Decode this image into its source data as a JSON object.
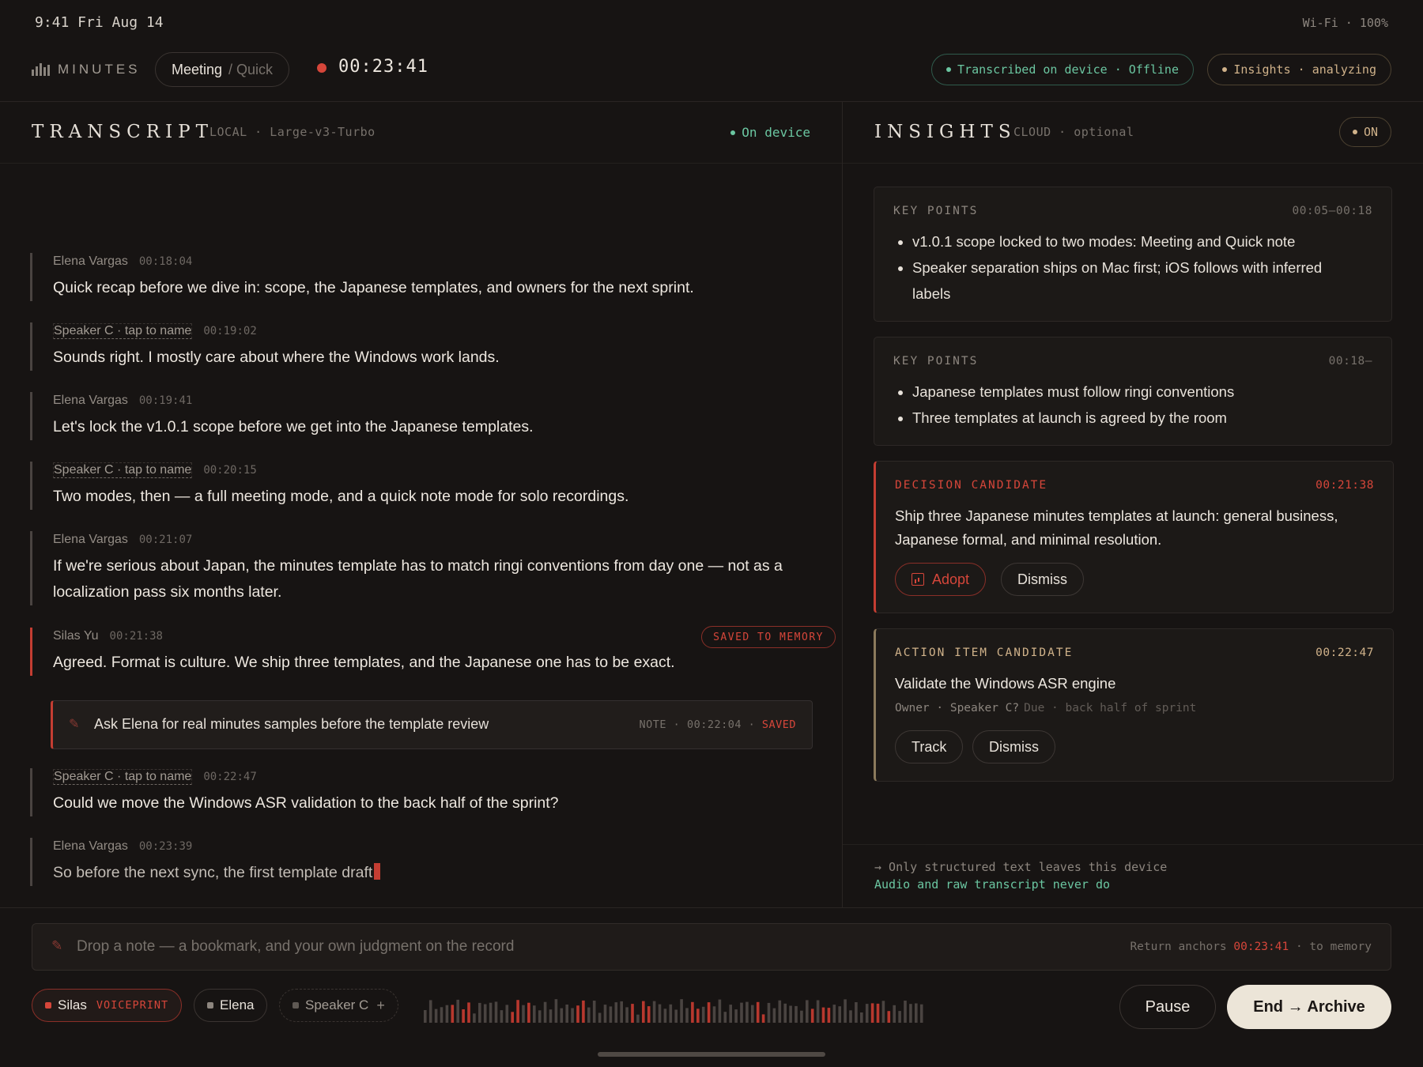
{
  "status": {
    "time": "9:41 Fri Aug 14",
    "system": "Wi-Fi · 100%"
  },
  "header": {
    "brand": "MINUTES",
    "mode_primary": "Meeting",
    "mode_secondary": "/ Quick",
    "timer": "00:23:41",
    "transcribed_pill": "Transcribed on device · Offline",
    "insights_pill": "Insights · analyzing"
  },
  "transcript": {
    "title": "TRANSCRIPT",
    "subtitle": "LOCAL · Large-v3-Turbo",
    "status": "On device",
    "utterances": [
      {
        "speaker": "Elena Vargas",
        "time": "00:18:04",
        "text": "Quick recap before we dive in: scope, the Japanese templates, and owners for the next sprint."
      },
      {
        "speaker": "Speaker C · tap to name",
        "time": "00:19:02",
        "text": "Sounds right. I mostly care about where the Windows work lands."
      },
      {
        "speaker": "Elena Vargas",
        "time": "00:19:41",
        "text": "Let's lock the v1.0.1 scope before we get into the Japanese templates."
      },
      {
        "speaker": "Speaker C · tap to name",
        "time": "00:20:15",
        "text": "Two modes, then — a full meeting mode, and a quick note mode for solo recordings."
      },
      {
        "speaker": "Elena Vargas",
        "time": "00:21:07",
        "text": "If we're serious about Japan, the minutes template has to match ringi conventions from day one — not as a localization pass six months later."
      },
      {
        "speaker": "Silas Yu",
        "time": "00:21:38",
        "text": "Agreed. Format is culture. We ship three templates, and the Japanese one has to be exact.",
        "tag": "SAVED TO MEMORY"
      },
      {
        "speaker": "Speaker C · tap to name",
        "time": "00:22:47",
        "text": "Could we move the Windows ASR validation to the back half of the sprint?"
      },
      {
        "speaker": "Elena Vargas",
        "time": "00:23:39",
        "text": "So before the next sync, the first template draft"
      }
    ],
    "note": {
      "text": "Ask Elena for real minutes samples before the template review",
      "meta": "NOTE · 00:22:04 ·",
      "saved": "SAVED"
    }
  },
  "insights": {
    "title": "INSIGHTS",
    "subtitle": "CLOUD · optional",
    "toggle": "ON",
    "cards": [
      {
        "label": "KEY POINTS",
        "time": "00:05–00:18",
        "bullets": [
          "v1.0.1 scope locked to two modes: Meeting and Quick note",
          "Speaker separation ships on Mac first; iOS follows with inferred labels"
        ]
      },
      {
        "label": "KEY POINTS",
        "time": "00:18–",
        "bullets": [
          "Japanese templates must follow ringi conventions",
          "Three templates at launch is agreed by the room"
        ]
      },
      {
        "label": "DECISION CANDIDATE",
        "time": "00:21:38",
        "text": "Ship three Japanese minutes templates at launch: general business, Japanese formal, and minimal resolution.",
        "primary": "Adopt",
        "secondary": "Dismiss"
      },
      {
        "label": "ACTION ITEM CANDIDATE",
        "time": "00:22:47",
        "text": "Validate the Windows ASR engine",
        "owner": "Owner · Speaker C?",
        "due": "Due · back half of sprint",
        "primary": "Track",
        "secondary": "Dismiss"
      }
    ],
    "privacy_line1": "→ Only structured text leaves this device",
    "privacy_line2": "Audio and raw transcript never do"
  },
  "composer": {
    "placeholder": "Drop a note — a bookmark, and your own judgment on the record",
    "hint_prefix": "Return anchors",
    "hint_time": "00:23:41",
    "hint_suffix": "· to memory"
  },
  "speakers": {
    "silas": "Silas",
    "voiceprint": "VOICEPRINT",
    "elena": "Elena",
    "speaker_c": "Speaker C",
    "add": "+"
  },
  "controls": {
    "pause": "Pause",
    "end": "End → Archive"
  },
  "colors": {
    "accent_red": "#d6463a",
    "accent_green": "#6bc6a1",
    "accent_amber": "#d0b28a",
    "background": "#171413"
  }
}
